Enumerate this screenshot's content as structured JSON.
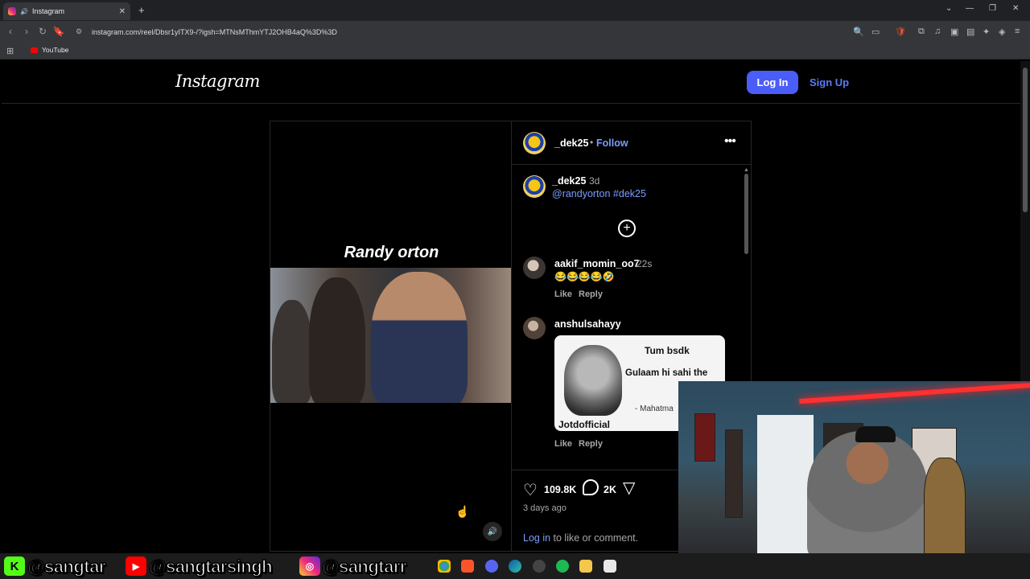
{
  "browser": {
    "tab_title": "Instagram",
    "new_tab": "+",
    "url": "instagram.com/reel/Dbsr1yITX9-/?igsh=MTNsMThmYTJ2OHB4aQ%3D%3D",
    "bookmark": "YouTube"
  },
  "instagram": {
    "logo": "Instagram",
    "login_label": "Log In",
    "signup_label": "Sign Up"
  },
  "reel": {
    "caption": "Randy orton"
  },
  "post": {
    "author": "_dek25",
    "dot": "•",
    "follow_label": "Follow",
    "caption_user": "_dek25",
    "caption_time": "3d",
    "caption_text": "@randyorton #dek25",
    "comments": [
      {
        "user": "aakif_momin_oo7",
        "time": "22s",
        "text": "😂😂😂😂🤣",
        "like": "Like",
        "reply": "Reply"
      },
      {
        "user": "anshulsahayy",
        "time": "",
        "like": "Like",
        "reply": "Reply"
      }
    ],
    "meme": {
      "line1": "Tum bsdk",
      "line2": "Gulaam hi sahi the",
      "line3": "- Mahatma",
      "watermark": "Jotdofficial"
    },
    "likes": "109.8K",
    "comment_count": "2K",
    "age": "3 days ago",
    "login_link": "Log in",
    "login_rest": " to like or comment."
  },
  "banner": {
    "handle_k": "@sangtar",
    "handle_yt": "@sangtarsingh",
    "handle_ig": "@sangtarr"
  }
}
